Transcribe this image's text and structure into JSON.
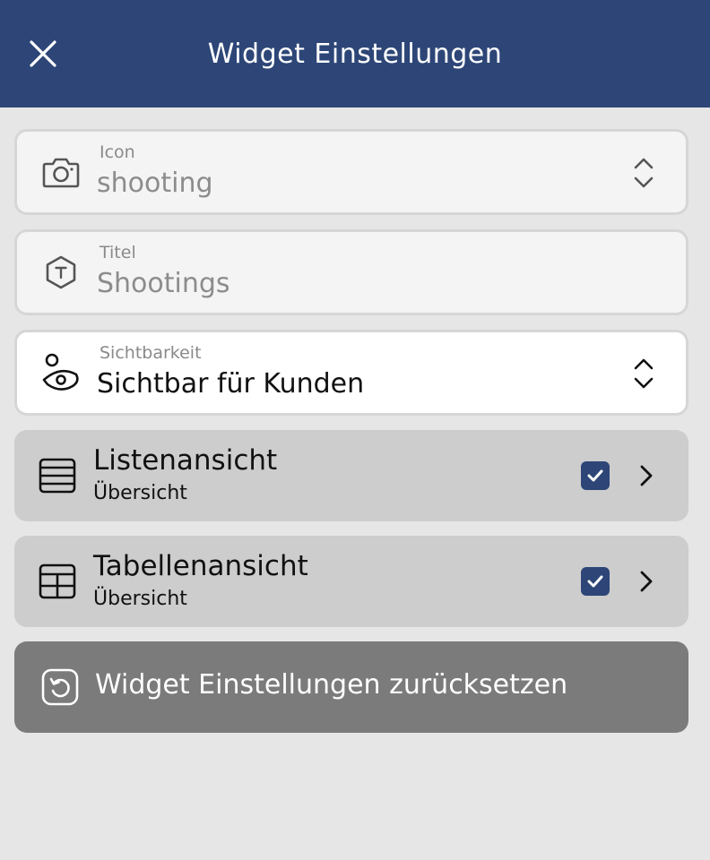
{
  "header": {
    "title": "Widget Einstellungen",
    "close_icon": "close-icon",
    "background": "#2d4677"
  },
  "fields": {
    "icon": {
      "label": "Icon",
      "value": "shooting",
      "icon": "camera-icon"
    },
    "title": {
      "label": "Titel",
      "value": "Shootings",
      "icon": "title-hexagon-icon"
    },
    "visibility": {
      "label": "Sichtbarkeit",
      "value": "Sichtbar für Kunden",
      "icon": "visibility-eye-icon"
    }
  },
  "views": [
    {
      "title": "Listenansicht",
      "subtitle": "Übersicht",
      "checked": true,
      "icon": "list-view-icon"
    },
    {
      "title": "Tabellenansicht",
      "subtitle": "Übersicht",
      "checked": true,
      "icon": "table-view-icon"
    }
  ],
  "reset": {
    "label": "Widget Einstellungen zurücksetzen",
    "icon": "reset-icon"
  },
  "colors": {
    "accent": "#2d4677",
    "row_bg": "#cdcdcd",
    "reset_bg": "#7b7b7b"
  }
}
